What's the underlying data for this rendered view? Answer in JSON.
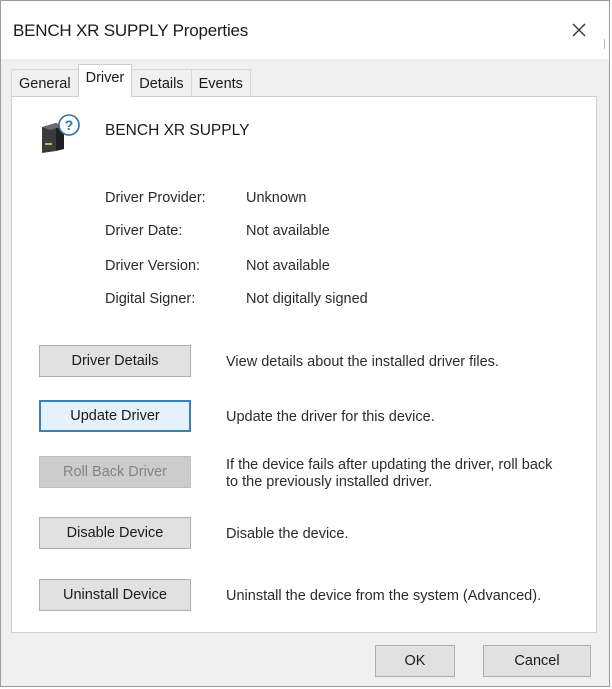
{
  "window": {
    "title": "BENCH XR SUPPLY Properties",
    "close_icon": "close-icon"
  },
  "tabs": [
    {
      "label": "General",
      "active": false
    },
    {
      "label": "Driver",
      "active": true
    },
    {
      "label": "Details",
      "active": false
    },
    {
      "label": "Events",
      "active": false
    }
  ],
  "device": {
    "icon": "unknown-device-icon",
    "name": "BENCH XR SUPPLY"
  },
  "info": [
    {
      "label": "Driver Provider:",
      "value": "Unknown"
    },
    {
      "label": "Driver Date:",
      "value": "Not available"
    },
    {
      "label": "Driver Version:",
      "value": "Not available"
    },
    {
      "label": "Digital Signer:",
      "value": "Not digitally signed"
    }
  ],
  "actions": [
    {
      "label": "Driver Details",
      "description": "View details about the installed driver files.",
      "enabled": true,
      "focused": false
    },
    {
      "label": "Update Driver",
      "description": "Update the driver for this device.",
      "enabled": true,
      "focused": true
    },
    {
      "label": "Roll Back Driver",
      "description": "If the device fails after updating the driver, roll back to the previously installed driver.",
      "enabled": false,
      "focused": false
    },
    {
      "label": "Disable Device",
      "description": "Disable the device.",
      "enabled": true,
      "focused": false
    },
    {
      "label": "Uninstall Device",
      "description": "Uninstall the device from the system (Advanced).",
      "enabled": true,
      "focused": false
    }
  ],
  "footer": {
    "ok_label": "OK",
    "cancel_label": "Cancel"
  },
  "colors": {
    "focus_border": "#3c7fb1",
    "disabled_text": "#838383",
    "dialog_background": "#f0f0f0"
  }
}
